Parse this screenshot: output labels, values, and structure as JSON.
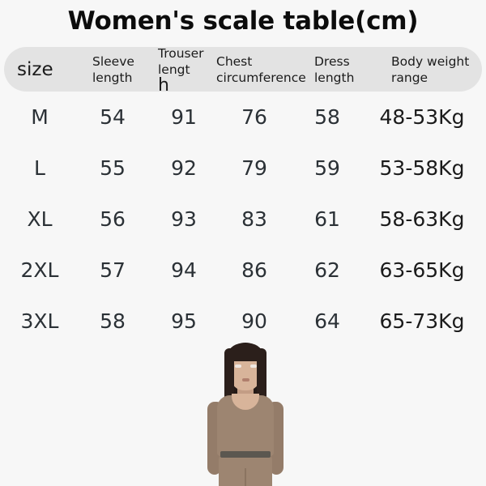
{
  "title": "Women's scale table(cm)",
  "theme": {
    "page_background": "#f7f7f7",
    "header_row_background": "#e3e3e3",
    "text_color": "#1b1b1b",
    "value_color": "#2b3136",
    "garment_color": "#9d8571",
    "belt_color": "#5b5750",
    "hair_color": "#2b1f1b",
    "skin_color": "#d8b49a"
  },
  "table": {
    "headers": {
      "size": {
        "line1": "size",
        "line2": ""
      },
      "sleeve_length": {
        "line1": "Sleeve",
        "line2": "length"
      },
      "trouser_length": {
        "line1": "Trouser",
        "line2": "lengt",
        "line2_tail": "h"
      },
      "chest_circumference": {
        "line1": "Chest",
        "line2": "circumference"
      },
      "dress_length": {
        "line1": "Dress",
        "line2": "length"
      },
      "body_weight_range": {
        "line1": "Body weight",
        "line2": "range"
      }
    },
    "rows": [
      {
        "size": "M",
        "sleeve_length": "54",
        "trouser_length": "91",
        "chest_circumference": "76",
        "dress_length": "58",
        "body_weight_range": "48-53Kg"
      },
      {
        "size": "L",
        "sleeve_length": "55",
        "trouser_length": "92",
        "chest_circumference": "79",
        "dress_length": "59",
        "body_weight_range": "53-58Kg"
      },
      {
        "size": "XL",
        "sleeve_length": "56",
        "trouser_length": "93",
        "chest_circumference": "83",
        "dress_length": "61",
        "body_weight_range": "58-63Kg"
      },
      {
        "size": "2XL",
        "sleeve_length": "57",
        "trouser_length": "94",
        "chest_circumference": "86",
        "dress_length": "62",
        "body_weight_range": "63-65Kg"
      },
      {
        "size": "3XL",
        "sleeve_length": "58",
        "trouser_length": "95",
        "chest_circumference": "90",
        "dress_length": "64",
        "body_weight_range": "65-73Kg"
      }
    ]
  },
  "model_photo": {
    "description": "Woman wearing taupe long-sleeve scoop-neck top and matching leggings with dark belt"
  }
}
